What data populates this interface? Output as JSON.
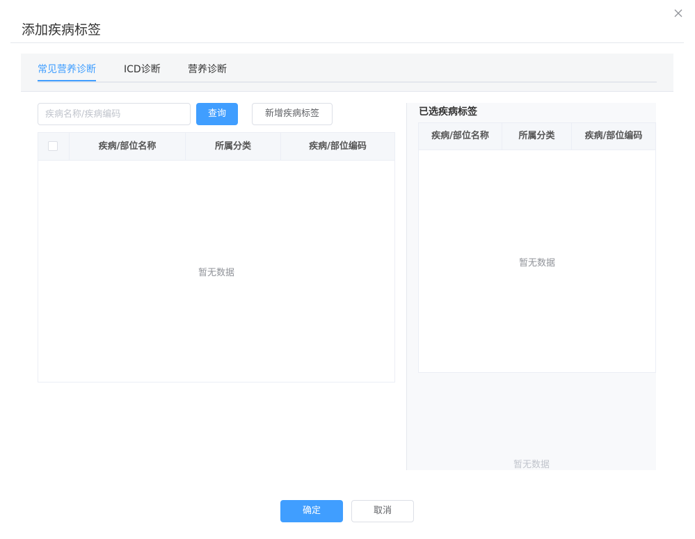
{
  "dialog": {
    "title": "添加疾病标签",
    "close_icon": "close-icon"
  },
  "tabs": [
    {
      "label": "常见营养诊断",
      "active": true
    },
    {
      "label": "ICD诊断",
      "active": false
    },
    {
      "label": "营养诊断",
      "active": false
    }
  ],
  "search": {
    "placeholder": "疾病名称/疾病编码",
    "value": "",
    "query_label": "查询",
    "add_label": "新增疾病标签"
  },
  "left_table": {
    "columns": [
      "疾病/部位名称",
      "所属分类",
      "疾病/部位编码"
    ],
    "rows": [],
    "empty_text": "暂无数据"
  },
  "right_panel": {
    "title": "已选疾病标签",
    "columns": [
      "疾病/部位名称",
      "所属分类",
      "疾病/部位编码"
    ],
    "rows": [],
    "empty_text": "暂无数据",
    "faint_empty_text": "暂无数据"
  },
  "footer": {
    "confirm_label": "确定",
    "cancel_label": "取消"
  },
  "colors": {
    "primary": "#409eff",
    "border": "#dcdfe6",
    "panel_bg": "#f8f9fb",
    "tabs_bg": "#f5f6f7"
  }
}
